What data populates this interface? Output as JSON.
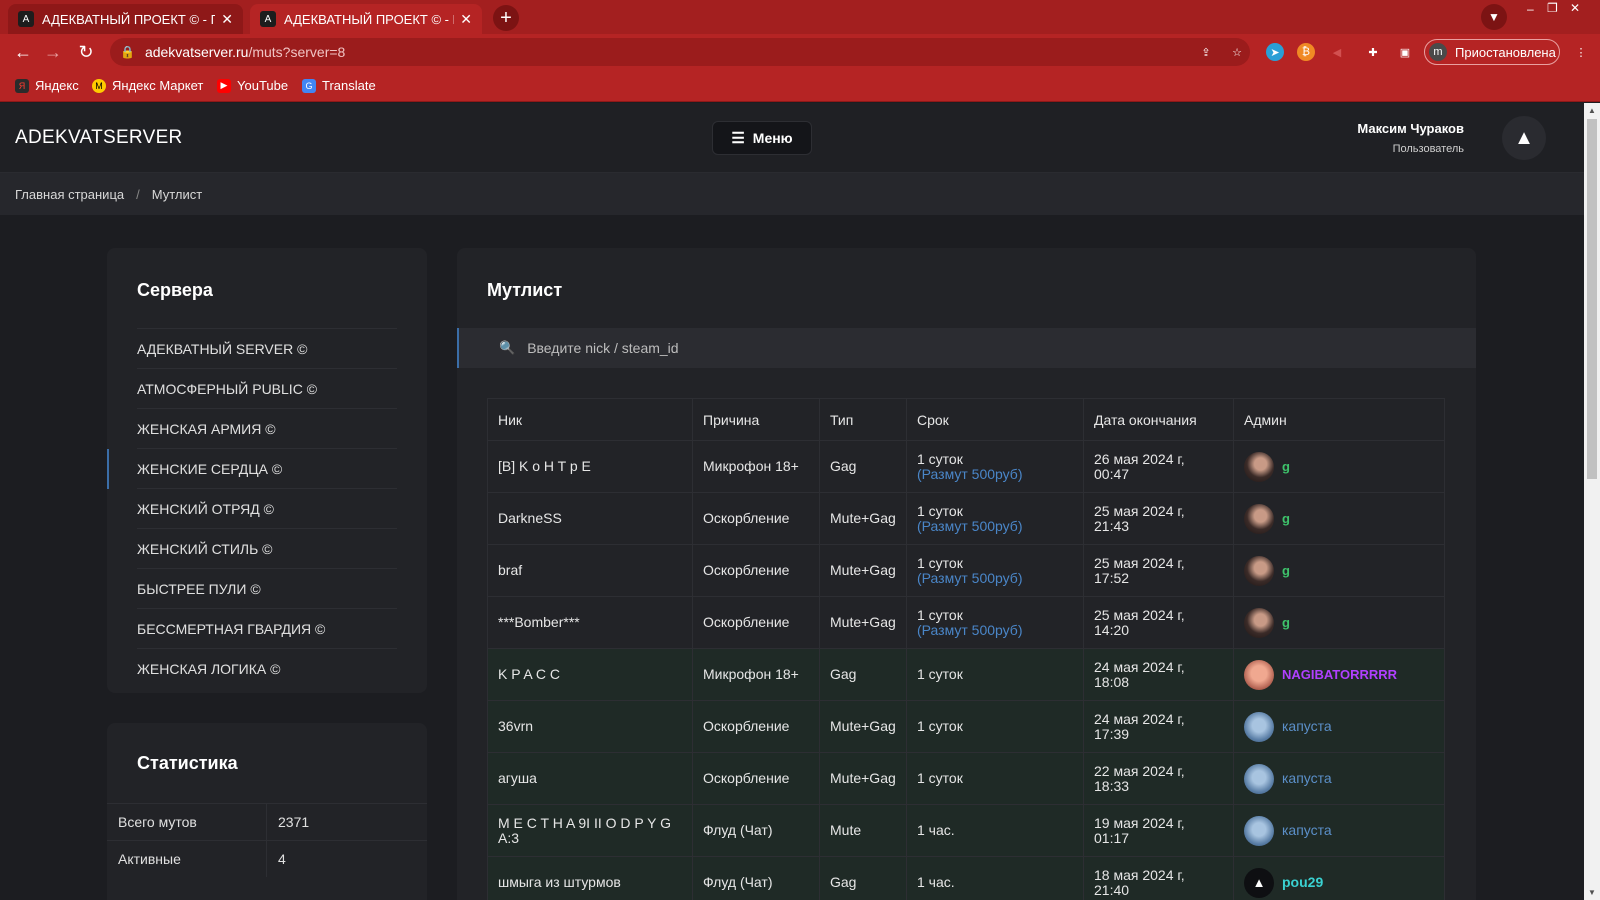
{
  "browser": {
    "tabs": [
      {
        "title": "АДЕКВАТНЫЙ ПРОЕКТ © - Главная"
      },
      {
        "title": "АДЕКВАТНЫЙ ПРОЕКТ © - Мутлист"
      }
    ],
    "url_host": "adekvatserver.ru",
    "url_path": "/muts?server=8",
    "profile_initial": "m",
    "profile_label": "Приостановлена",
    "bookmarks": [
      {
        "label": "Яндекс"
      },
      {
        "label": "Яндекс Маркет"
      },
      {
        "label": "YouTube"
      },
      {
        "label": "Translate"
      }
    ]
  },
  "header": {
    "brand": "ADEKVATSERVER",
    "menu_label": "Меню",
    "user_name": "Максим Чураков",
    "user_role": "Пользователь"
  },
  "breadcrumb": {
    "home": "Главная страница",
    "current": "Мутлист"
  },
  "sidebar": {
    "title": "Сервера",
    "servers": [
      {
        "label": "АДЕКВАТНЫЙ SERVER ©"
      },
      {
        "label": "АТМОСФЕРНЫЙ PUBLIC ©"
      },
      {
        "label": "ЖЕНСКАЯ АРМИЯ ©"
      },
      {
        "label": "ЖЕНСКИЕ СЕРДЦА ©"
      },
      {
        "label": "ЖЕНСКИЙ ОТРЯД ©"
      },
      {
        "label": "ЖЕНСКИЙ СТИЛЬ ©"
      },
      {
        "label": "БЫСТРЕЕ ПУЛИ ©"
      },
      {
        "label": "БЕССМЕРТНАЯ ГВАРДИЯ ©"
      },
      {
        "label": "ЖЕНСКАЯ ЛОГИКА ©"
      }
    ]
  },
  "stats": {
    "title": "Статистика",
    "rows": [
      {
        "label": "Всего мутов",
        "value": "2371"
      },
      {
        "label": "Активные",
        "value": "4"
      }
    ]
  },
  "main": {
    "title": "Мутлист",
    "search_placeholder": "Введите nick / steam_id",
    "columns": [
      "Ник",
      "Причина",
      "Тип",
      "Срок",
      "Дата окончания",
      "Админ"
    ],
    "rows": [
      {
        "nick": "[B] K o H T p E",
        "reason": "Микрофон 18+",
        "type": "Gag",
        "term": "1 суток",
        "term_sub": "(Размут 500руб)",
        "date1": "26 мая 2024 г,",
        "date2": "00:47",
        "admin": "g"
      },
      {
        "nick": "DarkneSS",
        "reason": "Оскорбление",
        "type": "Mute+Gag",
        "term": "1 суток",
        "term_sub": "(Размут 500руб)",
        "date1": "25 мая 2024 г,",
        "date2": "21:43",
        "admin": "g"
      },
      {
        "nick": "braf",
        "reason": "Оскорбление",
        "type": "Mute+Gag",
        "term": "1 суток",
        "term_sub": "(Размут 500руб)",
        "date1": "25 мая 2024 г,",
        "date2": "17:52",
        "admin": "g"
      },
      {
        "nick": "***Bomber***",
        "reason": "Оскорбление",
        "type": "Mute+Gag",
        "term": "1 суток",
        "term_sub": "(Размут 500руб)",
        "date1": "25 мая 2024 г,",
        "date2": "14:20",
        "admin": "g"
      },
      {
        "nick": "K P A C C",
        "reason": "Микрофон 18+",
        "type": "Gag",
        "term": "1 суток",
        "date1": "24 мая 2024 г,",
        "date2": "18:08",
        "admin": "NAGIBATORRRRR"
      },
      {
        "nick": "36vrn",
        "reason": "Оскорбление",
        "type": "Mute+Gag",
        "term": "1 суток",
        "date1": "24 мая 2024 г,",
        "date2": "17:39",
        "admin": "капуста"
      },
      {
        "nick": "агуша",
        "reason": "Оскорбление",
        "type": "Mute+Gag",
        "term": "1 суток",
        "date1": "22 мая 2024 г,",
        "date2": "18:33",
        "admin": "капуста"
      },
      {
        "nick": "M E C T H A 9I II O D P Y G A:3",
        "reason": "Флуд (Чат)",
        "type": "Mute",
        "term": "1 час.",
        "date1": "19 мая 2024 г,",
        "date2": "01:17",
        "admin": "капуста"
      },
      {
        "nick": "шмыга из штурмов",
        "reason": "Флуд (Чат)",
        "type": "Gag",
        "term": "1 час.",
        "date1": "18 мая 2024 г,",
        "date2": "21:40",
        "admin": "pou29"
      }
    ]
  }
}
